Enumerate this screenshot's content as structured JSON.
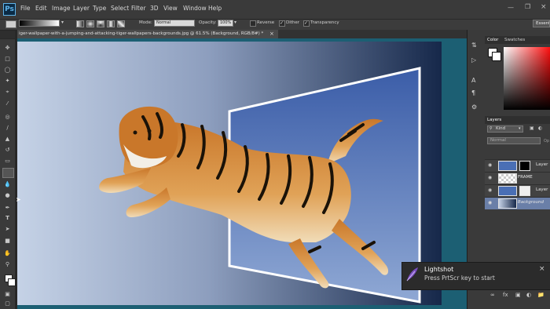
{
  "app": {
    "logo_text": "Ps"
  },
  "menu": [
    "File",
    "Edit",
    "Image",
    "Layer",
    "Type",
    "Select",
    "Filter",
    "3D",
    "View",
    "Window",
    "Help"
  ],
  "options_bar": {
    "mode_label": "Mode:",
    "mode_value": "Normal",
    "opacity_label": "Opacity:",
    "opacity_value": "100%",
    "reverse_label": "Reverse",
    "dither_label": "Dither",
    "transparency_label": "Transparency",
    "workspace_label": "Essent"
  },
  "document": {
    "tab_title": "iger-wallpaper-with-a-jumping-and-attacking-tiger-wallpapers-backgrounds.jpg @ 61.5% (Background, RGB/8#) *",
    "tab_close": "×"
  },
  "panels": {
    "color_tab": "Color",
    "swatches_tab": "Swatches",
    "layers_tab": "Layers",
    "kind_label": "Kind",
    "blend_value": "Normal",
    "opacity_short": "Op",
    "layers": [
      {
        "name": "Layer",
        "italic": false
      },
      {
        "name": "FRAME",
        "italic": false
      },
      {
        "name": "Layer",
        "italic": false
      },
      {
        "name": "Background",
        "italic": true
      }
    ]
  },
  "toast": {
    "title": "Lightshot",
    "message": "Press PrtScr key to start",
    "close": "×"
  },
  "colors": {
    "accent": "#5fb4ea",
    "canvas_border": "#1c5f73",
    "toast_icon": "#7a4fc0"
  }
}
